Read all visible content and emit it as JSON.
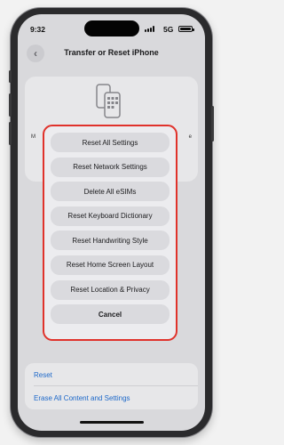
{
  "status_bar": {
    "time": "9:32",
    "network": "5G"
  },
  "nav": {
    "title": "Transfer or Reset iPhone"
  },
  "info_card": {
    "left_edge": "M",
    "right_edge": "e"
  },
  "action_sheet": {
    "items": [
      "Reset All Settings",
      "Reset Network Settings",
      "Delete All eSIMs",
      "Reset Keyboard Dictionary",
      "Reset Handwriting Style",
      "Reset Home Screen Layout",
      "Reset Location & Privacy"
    ],
    "cancel": "Cancel",
    "highlight_color": "#e0322b"
  },
  "bottom_list": {
    "reset": "Reset",
    "erase": "Erase All Content and Settings"
  },
  "colors": {
    "link": "#1f6fd6"
  }
}
